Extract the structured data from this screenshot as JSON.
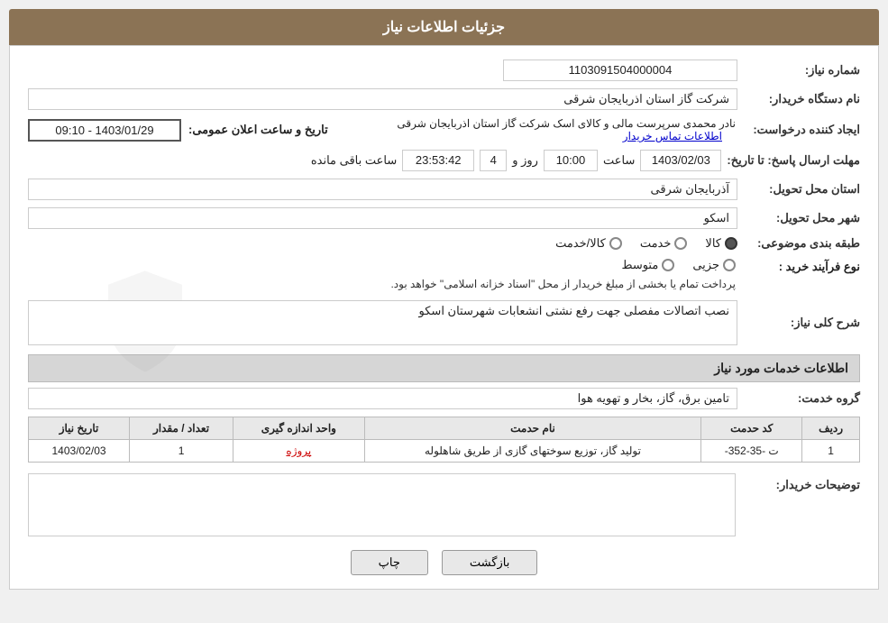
{
  "page": {
    "title": "جزئیات اطلاعات نیاز",
    "header_bg": "#8B7355"
  },
  "fields": {
    "need_number_label": "شماره نیاز:",
    "need_number_value": "1103091504000004",
    "buyer_org_label": "نام دستگاه خریدار:",
    "buyer_org_value": "شرکت گاز استان اذربایجان شرقی",
    "creator_label": "ایجاد کننده درخواست:",
    "creator_name": "نادر محمدی سرپرست مالی و کالای اسک شرکت گاز استان اذربایجان شرقی",
    "contact_link": "اطلاعات تماس خریدار",
    "date_label": "تاریخ و ساعت اعلان عمومی:",
    "date_value": "1403/01/29 - 09:10",
    "deadline_label": "مهلت ارسال پاسخ: تا تاریخ:",
    "deadline_date": "1403/02/03",
    "deadline_time_label": "ساعت",
    "deadline_time": "10:00",
    "deadline_days_label": "روز و",
    "deadline_days": "4",
    "deadline_remaining_label": "ساعت باقی مانده",
    "deadline_remaining": "23:53:42",
    "province_label": "استان محل تحویل:",
    "province_value": "آذربایجان شرقی",
    "city_label": "شهر محل تحویل:",
    "city_value": "اسکو",
    "category_label": "طبقه بندی موضوعی:",
    "category_options": [
      {
        "label": "کالا",
        "selected": true
      },
      {
        "label": "خدمت",
        "selected": false
      },
      {
        "label": "کالا/خدمت",
        "selected": false
      }
    ],
    "purchase_type_label": "نوع فرآیند خرید :",
    "purchase_options": [
      {
        "label": "جزیی",
        "selected": false
      },
      {
        "label": "متوسط",
        "selected": false
      }
    ],
    "purchase_note": "پرداخت تمام یا بخشی از مبلغ خریدار از محل \"اسناد خزانه اسلامی\" خواهد بود.",
    "need_desc_label": "شرح کلی نیاز:",
    "need_desc_value": "نصب اتصالات مفصلی جهت رفع نشتی انشعابات شهرستان اسکو",
    "services_section_label": "اطلاعات خدمات مورد نیاز",
    "service_group_label": "گروه خدمت:",
    "service_group_value": "تامین برق، گاز، بخار و تهویه هوا",
    "table": {
      "columns": [
        "ردیف",
        "کد حدمت",
        "نام حدمت",
        "واحد اندازه گیری",
        "تعداد / مقدار",
        "تاریخ نیاز"
      ],
      "rows": [
        {
          "row": "1",
          "code": "ت -35-352-",
          "name": "تولید گاز، توزیع سوختهای گازی از طریق شاهلوله",
          "unit": "پروژه",
          "qty": "1",
          "date": "1403/02/03"
        }
      ]
    },
    "buyer_notes_label": "توضیحات خریدار:",
    "buyer_notes_value": "",
    "btn_print": "چاپ",
    "btn_back": "بازگشت"
  }
}
